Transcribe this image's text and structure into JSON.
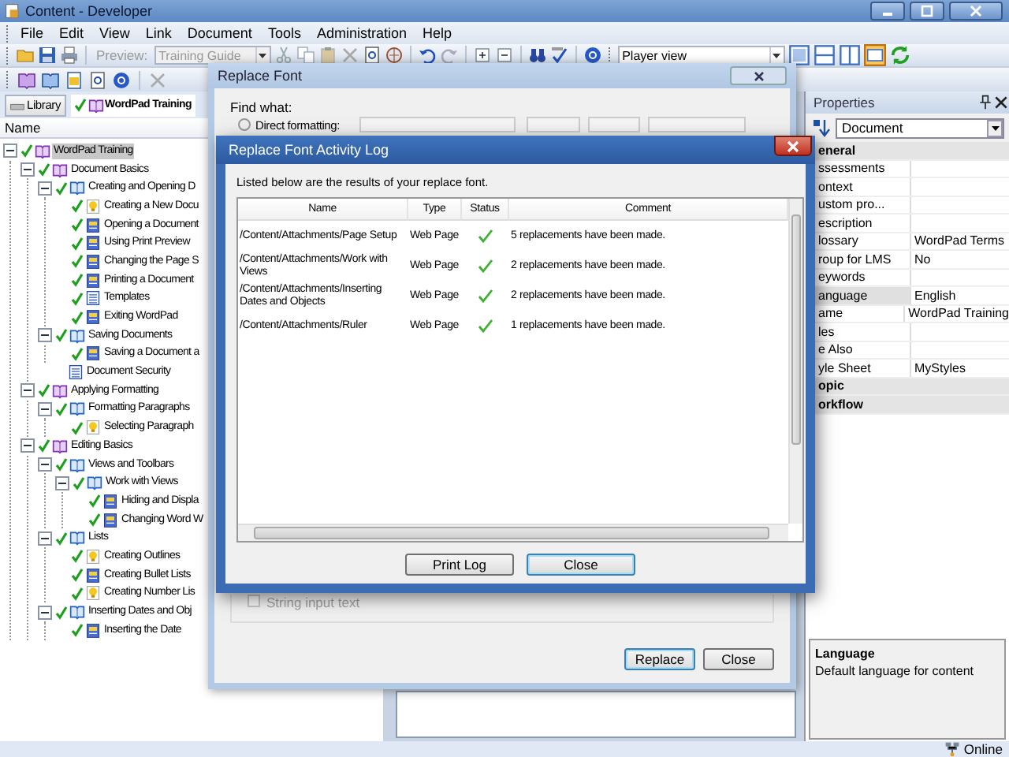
{
  "window": {
    "title": "Content - Developer"
  },
  "menu": [
    "File",
    "Edit",
    "View",
    "Link",
    "Document",
    "Tools",
    "Administration",
    "Help"
  ],
  "toolbar": {
    "preview": {
      "label": "Preview:",
      "value": "Training Guide",
      "disabled": true
    },
    "view": {
      "value": "Player view"
    }
  },
  "tabs": [
    {
      "label": "Library",
      "selected": false
    },
    {
      "label": "WordPad Training",
      "selected": true
    }
  ],
  "outline": {
    "column": "Name",
    "tree": [
      {
        "label": "WordPad Training",
        "kind": "book",
        "checked": true,
        "selected": true,
        "expanded": true,
        "children": [
          {
            "label": "Document Basics",
            "kind": "book",
            "checked": true,
            "selected": false,
            "expanded": true,
            "children": [
              {
                "label": "Creating and Opening D",
                "kind": "section",
                "checked": true,
                "selected": false,
                "expanded": true,
                "children": [
                  {
                    "label": "Creating a New Docu",
                    "kind": "topic",
                    "checked": true,
                    "selected": false
                  },
                  {
                    "label": "Opening a Document",
                    "kind": "page",
                    "checked": true,
                    "selected": false
                  },
                  {
                    "label": "Using Print Preview",
                    "kind": "page",
                    "checked": true,
                    "selected": false
                  },
                  {
                    "label": "Changing the Page S",
                    "kind": "page",
                    "checked": true,
                    "selected": false
                  },
                  {
                    "label": "Printing a Document",
                    "kind": "page",
                    "checked": true,
                    "selected": false
                  },
                  {
                    "label": "Templates",
                    "kind": "document",
                    "checked": true,
                    "selected": false
                  },
                  {
                    "label": "Exiting WordPad",
                    "kind": "page",
                    "checked": true,
                    "selected": false
                  }
                ]
              },
              {
                "label": "Saving Documents",
                "kind": "section",
                "checked": true,
                "selected": false,
                "expanded": true,
                "children": [
                  {
                    "label": "Saving a Document a",
                    "kind": "page",
                    "checked": true,
                    "selected": false
                  }
                ]
              },
              {
                "label": "Document Security",
                "kind": "document",
                "checked": false,
                "selected": false
              }
            ]
          },
          {
            "label": "Applying Formatting",
            "kind": "book",
            "checked": true,
            "selected": false,
            "expanded": true,
            "children": [
              {
                "label": "Formatting Paragraphs",
                "kind": "section",
                "checked": true,
                "selected": false,
                "expanded": true,
                "children": [
                  {
                    "label": "Selecting Paragraph",
                    "kind": "topic",
                    "checked": true,
                    "selected": false
                  }
                ]
              }
            ]
          },
          {
            "label": "Editing Basics",
            "kind": "book",
            "checked": true,
            "selected": false,
            "expanded": true,
            "children": [
              {
                "label": "Views and Toolbars",
                "kind": "section",
                "checked": true,
                "selected": false,
                "expanded": true,
                "children": [
                  {
                    "label": "Work with Views",
                    "kind": "section",
                    "checked": true,
                    "selected": false,
                    "expanded": true,
                    "children": [
                      {
                        "label": "Hiding and Displa",
                        "kind": "page",
                        "checked": true,
                        "selected": false
                      },
                      {
                        "label": "Changing Word W",
                        "kind": "page",
                        "checked": true,
                        "selected": false
                      }
                    ]
                  }
                ]
              },
              {
                "label": "Lists",
                "kind": "section",
                "checked": true,
                "selected": false,
                "expanded": true,
                "children": [
                  {
                    "label": "Creating Outlines",
                    "kind": "topic",
                    "checked": true,
                    "selected": false
                  },
                  {
                    "label": "Creating Bullet Lists",
                    "kind": "page",
                    "checked": true,
                    "selected": false
                  },
                  {
                    "label": "Creating Number Lis",
                    "kind": "topic",
                    "checked": true,
                    "selected": false
                  }
                ]
              },
              {
                "label": "Inserting Dates and Obj",
                "kind": "section",
                "checked": true,
                "selected": false,
                "expanded": true,
                "children": [
                  {
                    "label": "Inserting the Date",
                    "kind": "page",
                    "checked": true,
                    "selected": false
                  }
                ]
              }
            ]
          }
        ]
      }
    ]
  },
  "properties": {
    "title": "Properties",
    "object": "Document",
    "rows": [
      {
        "kind": "category",
        "name": "eneral",
        "selected": false
      },
      {
        "kind": "property",
        "name": "ssessments",
        "selected": false
      },
      {
        "kind": "property",
        "name": "ontext",
        "selected": false
      },
      {
        "kind": "property",
        "name": "ustom pro...",
        "selected": false
      },
      {
        "kind": "property",
        "name": "escription",
        "selected": false
      },
      {
        "kind": "property",
        "name": "lossary",
        "value": "WordPad Terms",
        "selected": false
      },
      {
        "kind": "property",
        "name": "roup for LMS",
        "value": "No",
        "selected": false
      },
      {
        "kind": "property",
        "name": "eywords",
        "selected": false
      },
      {
        "kind": "property",
        "name": "anguage",
        "value": "English",
        "selected": true
      },
      {
        "kind": "property",
        "name": "ame",
        "value": "WordPad Training",
        "selected": false
      },
      {
        "kind": "property",
        "name": "les",
        "selected": false
      },
      {
        "kind": "property",
        "name": "e Also",
        "selected": false
      },
      {
        "kind": "property",
        "name": "yle Sheet",
        "value": "MyStyles",
        "selected": false
      },
      {
        "kind": "category",
        "name": "opic",
        "selected": false
      },
      {
        "kind": "category",
        "name": "orkflow",
        "selected": false
      }
    ],
    "description": {
      "title": "Language",
      "text": "Default language for content"
    }
  },
  "replace_font": {
    "title": "Replace Font",
    "find_label": "Find what:",
    "direct_formatting": {
      "label": "Direct formatting:",
      "selected": false
    },
    "string_input": {
      "label": "String input text",
      "checked": false,
      "disabled": true
    },
    "buttons": [
      "Replace",
      "Close"
    ]
  },
  "activity_log": {
    "title": "Replace Font Activity Log",
    "intro": "Listed below are the results of your replace font.",
    "columns": [
      "Name",
      "Type",
      "Status",
      "Comment"
    ],
    "rows": [
      {
        "name": "/Content/Attachments/Page Setup",
        "type": "Web Page",
        "succeeded": true,
        "comment": "5 replacements have been made."
      },
      {
        "name": "/Content/Attachments/Work with Views",
        "type": "Web Page",
        "succeeded": true,
        "comment": "2 replacements have been made."
      },
      {
        "name": "/Content/Attachments/Inserting Dates and Objects",
        "type": "Web Page",
        "succeeded": true,
        "comment": "2 replacements have been made."
      },
      {
        "name": "/Content/Attachments/Ruler",
        "type": "Web Page",
        "succeeded": true,
        "comment": "1 replacements have been made."
      }
    ],
    "buttons": [
      "Print Log",
      "Close"
    ]
  },
  "status_bar": {
    "connection": "Online"
  }
}
